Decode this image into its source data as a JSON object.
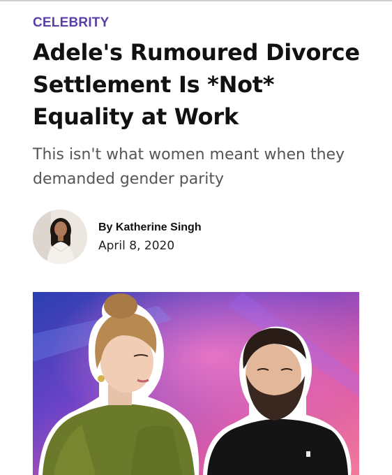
{
  "article": {
    "category": "CELEBRITY",
    "headline": "Adele's Rumoured Divorce Settlement Is *Not* Equality at Work",
    "dek": "This isn't what women meant when they demanded gender parity",
    "byline_prefix": "By",
    "author": "Katherine Singh",
    "date": "April 8, 2020",
    "author_photo": "author-avatar-photo",
    "hero_image": "adele-and-simon-konecki-photo"
  },
  "colors": {
    "category": "#5b3fa8",
    "headline": "#111111",
    "dek": "#555555",
    "hero_gradient": [
      "#2a3fb0",
      "#7b3fd0",
      "#e05fa8",
      "#f27a9a"
    ]
  }
}
